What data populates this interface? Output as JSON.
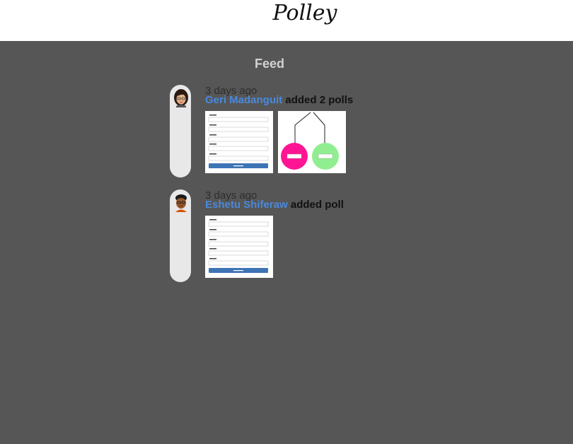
{
  "header": {
    "logo_text": "Polley"
  },
  "feed": {
    "title": "Feed",
    "items": [
      {
        "time": "3 days ago",
        "user": "Geri Madanguit",
        "action": "added 2 polls",
        "avatar_icon": "female-avatar-icon",
        "thumbnails": [
          "poll-form-preview",
          "poll-tree-preview"
        ]
      },
      {
        "time": "3 days ago",
        "user": "Eshetu Shiferaw",
        "action": "added poll",
        "avatar_icon": "male-avatar-icon",
        "thumbnails": [
          "poll-form-preview"
        ]
      }
    ]
  },
  "colors": {
    "background": "#565656",
    "header": "#ffffff",
    "user_link": "#4a89dc",
    "pill": "#e8e8e8",
    "create_button": "#3d74b5",
    "option_pink": "#ff1493",
    "option_green": "#90ee90"
  }
}
